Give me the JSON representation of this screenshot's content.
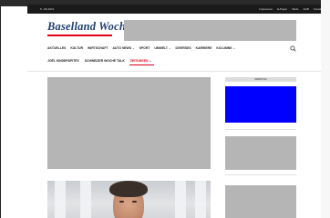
{
  "topbar": {
    "date": "5. Juli 2021",
    "links": [
      "Impressum",
      "E-Paper",
      "Tarife",
      "AGB",
      "Kontakt"
    ]
  },
  "logo": {
    "text": "Baselland Woche"
  },
  "nav_primary": [
    {
      "label": "AKTUELLES",
      "dropdown": false
    },
    {
      "label": "KULTUR",
      "dropdown": false
    },
    {
      "label": "WIRTSCHAFT",
      "dropdown": false
    },
    {
      "label": "AUTO NEWS",
      "dropdown": true
    },
    {
      "label": "SPORT",
      "dropdown": false
    },
    {
      "label": "UMWELT",
      "dropdown": true
    },
    {
      "label": "DIVERSES",
      "dropdown": false
    },
    {
      "label": "KARRIERE",
      "dropdown": false
    },
    {
      "label": "KOLUMNE",
      "dropdown": true
    }
  ],
  "nav_secondary": [
    {
      "label": "JOËL KINDERSPITEX",
      "active": false
    },
    {
      "label": "SCHWEIZER WOCHE TALK",
      "active": false
    },
    {
      "label": "ZEITUNGEN",
      "active": true
    }
  ],
  "sidebar": {
    "ad_label": "WERBUNG"
  },
  "colors": {
    "brand": "#1e3f73",
    "accent": "#e3001b",
    "ad_blue": "#0000ff",
    "placeholder": "#b5b5b5"
  },
  "icons": {
    "search": "search-icon",
    "dropdown": "chevron-down-icon"
  }
}
